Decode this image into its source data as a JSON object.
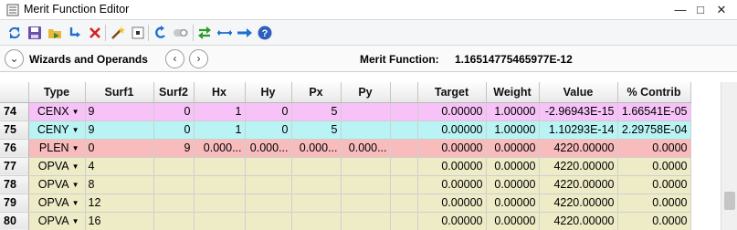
{
  "window": {
    "title": "Merit Function Editor"
  },
  "toolbar": {
    "buttons": [
      "refresh-icon",
      "save-icon",
      "load-icon",
      "insert-icon",
      "delete-icon",
      "wizard-icon",
      "stop-icon",
      "undo-icon",
      "toggle-icon",
      "update-icon",
      "collapse-icon",
      "arrow-icon",
      "help-icon"
    ]
  },
  "wizbar": {
    "label": "Wizards and Operands",
    "toggle_glyph": "⌄",
    "prev_glyph": "‹",
    "next_glyph": "›",
    "merit_label": "Merit Function:",
    "merit_value": "1.16514775465977E-12"
  },
  "grid": {
    "columns": [
      "",
      "Type",
      "Surf1",
      "Surf2",
      "Hx",
      "Hy",
      "Px",
      "Py",
      "",
      "Target",
      "Weight",
      "Value",
      "% Contrib"
    ],
    "rows": [
      {
        "n": "74",
        "type": "CENX",
        "surf1": "9",
        "surf2": "0",
        "hx": "1",
        "hy": "0",
        "px": "5",
        "py": "",
        "target": "0.00000",
        "weight": "1.00000",
        "value": "-2.96943E-15",
        "contrib": "1.66541E-05",
        "color": "#f7c2f7"
      },
      {
        "n": "75",
        "type": "CENY",
        "surf1": "9",
        "surf2": "0",
        "hx": "1",
        "hy": "0",
        "px": "5",
        "py": "",
        "target": "0.00000",
        "weight": "1.00000",
        "value": "1.10293E-14",
        "contrib": "2.29758E-04",
        "color": "#b9f3f3"
      },
      {
        "n": "76",
        "type": "PLEN",
        "surf1": "0",
        "surf2": "9",
        "hx": "0.000...",
        "hy": "0.000...",
        "px": "0.000...",
        "py": "0.000...",
        "target": "0.00000",
        "weight": "0.00000",
        "value": "4220.00000",
        "contrib": "0.0000",
        "color": "#f8bcbc"
      },
      {
        "n": "77",
        "type": "OPVA",
        "surf1": "4",
        "surf2": "",
        "hx": "",
        "hy": "",
        "px": "",
        "py": "",
        "target": "0.00000",
        "weight": "0.00000",
        "value": "4220.00000",
        "contrib": "0.0000",
        "color": "#eeebc7"
      },
      {
        "n": "78",
        "type": "OPVA",
        "surf1": "8",
        "surf2": "",
        "hx": "",
        "hy": "",
        "px": "",
        "py": "",
        "target": "0.00000",
        "weight": "0.00000",
        "value": "4220.00000",
        "contrib": "0.0000",
        "color": "#eeebc7"
      },
      {
        "n": "79",
        "type": "OPVA",
        "surf1": "12",
        "surf2": "",
        "hx": "",
        "hy": "",
        "px": "",
        "py": "",
        "target": "0.00000",
        "weight": "0.00000",
        "value": "4220.00000",
        "contrib": "0.0000",
        "color": "#eeebc7"
      },
      {
        "n": "80",
        "type": "OPVA",
        "surf1": "16",
        "surf2": "",
        "hx": "",
        "hy": "",
        "px": "",
        "py": "",
        "target": "0.00000",
        "weight": "0.00000",
        "value": "4220.00000",
        "contrib": "0.0000",
        "color": "#eeebc7"
      }
    ]
  }
}
